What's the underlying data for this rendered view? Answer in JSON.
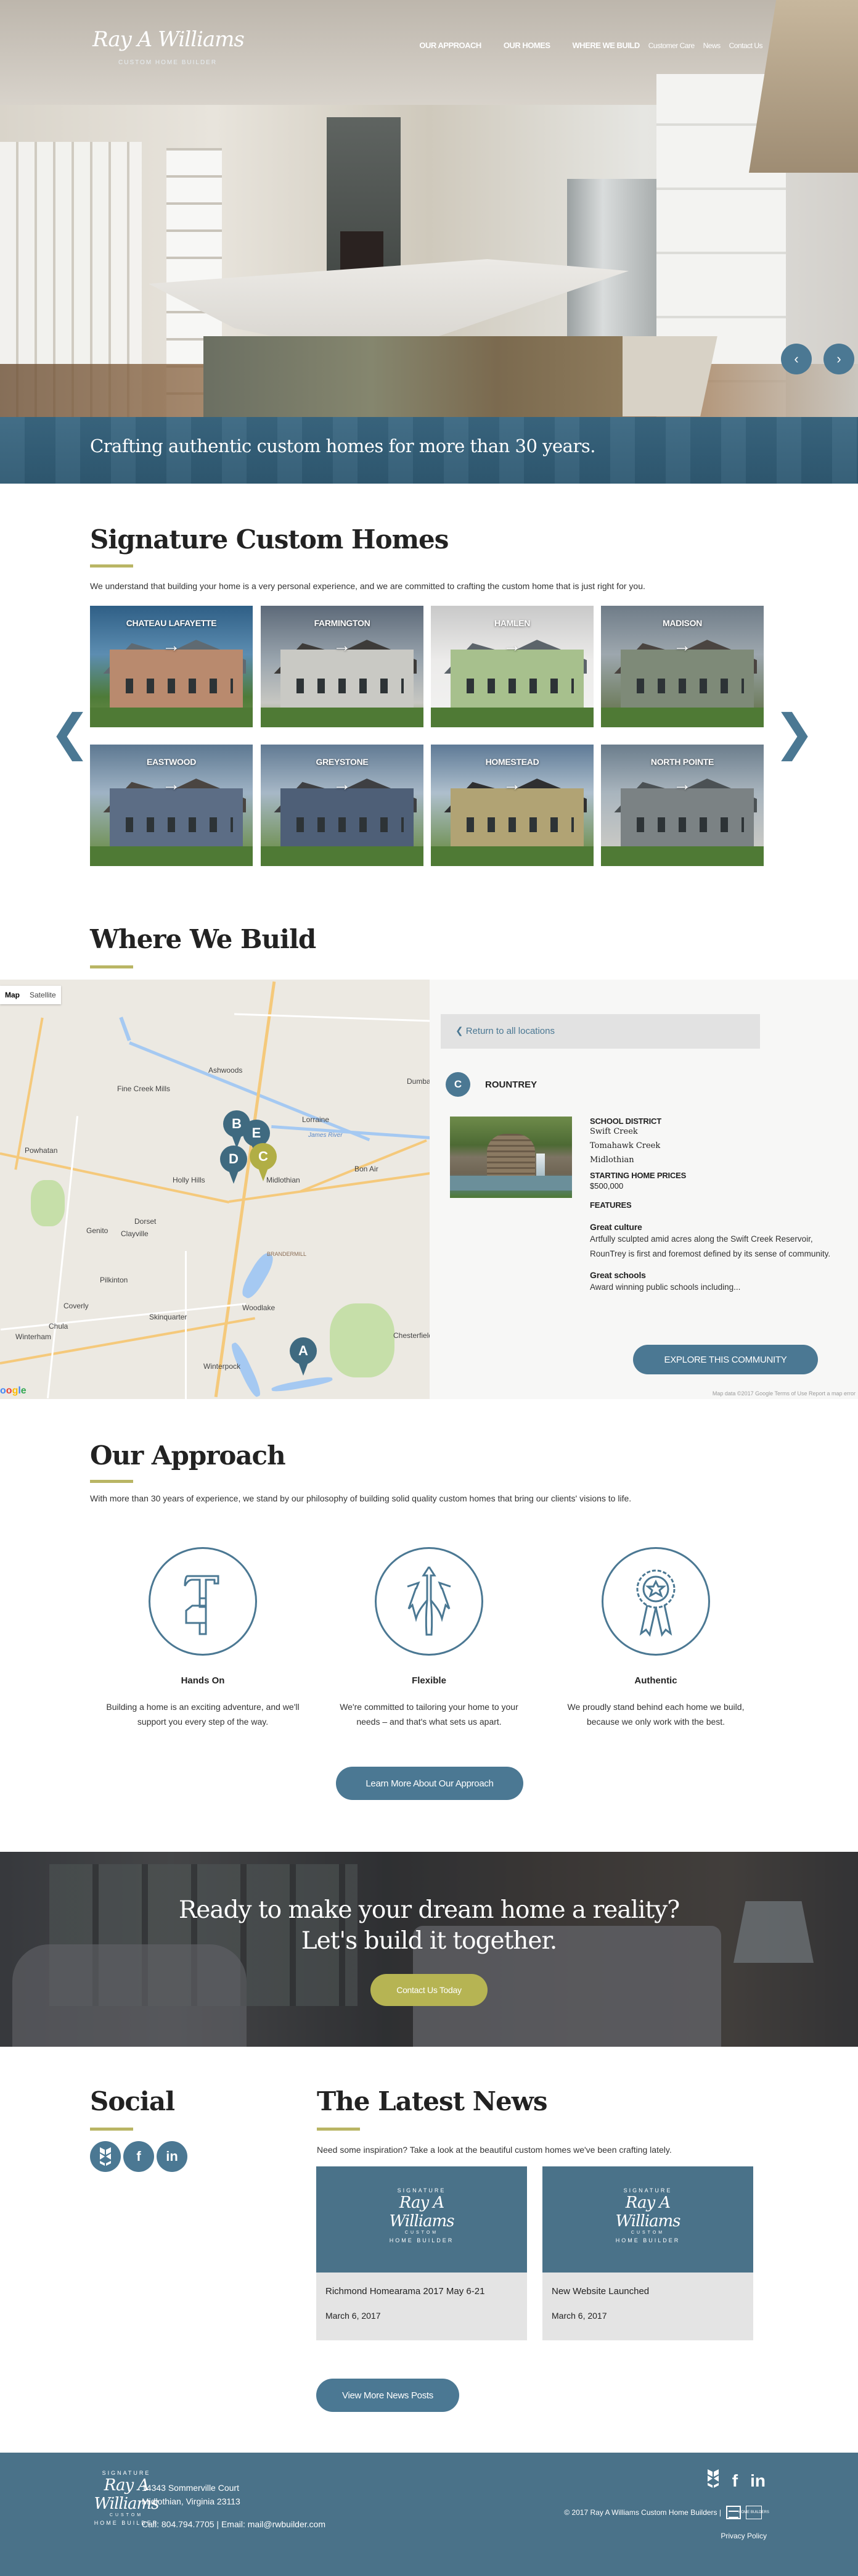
{
  "brand": {
    "logo_script": "Ray A Williams",
    "logo_sub": "CUSTOM HOME BUILDER",
    "emblem_top": "SIGNATURE",
    "emblem_mid": "CUSTOM",
    "emblem_bottom": "HOME BUILDER"
  },
  "nav": {
    "items": [
      {
        "label": "OUR APPROACH",
        "primary": true
      },
      {
        "label": "OUR HOMES",
        "primary": true
      },
      {
        "label": "WHERE WE BUILD",
        "primary": true
      },
      {
        "label": "Customer Care",
        "primary": false
      },
      {
        "label": "News",
        "primary": false
      },
      {
        "label": "Contact Us",
        "primary": false
      }
    ]
  },
  "hero": {
    "prev_icon": "‹",
    "next_icon": "›",
    "tagline": "Crafting authentic custom homes for more than 30 years."
  },
  "homes": {
    "title": "Signature Custom Homes",
    "lead": "We understand that building your home is a very personal experience, and we are committed to crafting the custom home that is just right for you.",
    "prev_icon": "❮",
    "next_icon": "❯",
    "arrow_icon": "→",
    "items": [
      {
        "name": "CHATEAU LAFAYETTE"
      },
      {
        "name": "FARMINGTON"
      },
      {
        "name": "HAMLEN"
      },
      {
        "name": "MADISON"
      },
      {
        "name": "EASTWOOD"
      },
      {
        "name": "GREYSTONE"
      },
      {
        "name": "HOMESTEAD"
      },
      {
        "name": "NORTH POINTE"
      }
    ]
  },
  "where": {
    "title": "Where We Build",
    "map_type": {
      "map": "Map",
      "satellite": "Satellite"
    },
    "map_labels": [
      "Ashwoods",
      "Fine Creek Mills",
      "Powhatan",
      "Lorraine",
      "James River",
      "Holly Hills",
      "Midlothian",
      "Bon Air",
      "Dorset",
      "Genito",
      "Clayville",
      "BRANDERMILL",
      "Pilkinton",
      "Woodlake",
      "Coverly",
      "Skinquarter",
      "Chula",
      "Winterham",
      "Chesterfield",
      "Winterpock",
      "Dumbarton"
    ],
    "pins": [
      {
        "letter": "B",
        "color": "#3f6a80"
      },
      {
        "letter": "E",
        "color": "#3f6a80"
      },
      {
        "letter": "D",
        "color": "#3f6a80"
      },
      {
        "letter": "C",
        "color": "#b1ae45"
      },
      {
        "letter": "A",
        "color": "#3f6a80"
      }
    ],
    "google_label": "Google",
    "return_label": "❮ Return to all locations",
    "community": {
      "badge": "C",
      "name": "ROUNTREY",
      "school_district_label": "SCHOOL DISTRICT",
      "schools": [
        "Swift Creek",
        "Tomahawk Creek",
        "Midlothian"
      ],
      "price_label": "STARTING HOME PRICES",
      "price": "$500,000",
      "features_label": "FEATURES",
      "features": [
        {
          "title": "Great culture",
          "text": "Artfully sculpted amid acres along the Swift Creek Reservoir, RounTrey is first and foremost defined by its sense of community."
        },
        {
          "title": "Great schools",
          "text": "Award winning public schools including..."
        }
      ],
      "explore_label": "EXPLORE THIS COMMUNITY"
    },
    "attribution": "Map data ©2017 Google   Terms of Use   Report a map error"
  },
  "approach": {
    "title": "Our Approach",
    "lead": "With more than 30 years of experience, we stand by our philosophy of building solid quality custom homes that bring our clients' visions to life.",
    "features": [
      {
        "icon": "hammer-icon",
        "title": "Hands On",
        "text": "Building a home is an exciting adventure, and we'll support you every step of the way."
      },
      {
        "icon": "diverging-arrows-icon",
        "title": "Flexible",
        "text": "We're committed to tailoring your home to your needs – and that's what sets us apart."
      },
      {
        "icon": "award-ribbon-icon",
        "title": "Authentic",
        "text": "We proudly stand behind each home we build, because we only work with the best."
      }
    ],
    "button_label": "Learn More About Our Approach"
  },
  "cta": {
    "line1": "Ready to make your dream home a reality?",
    "line2": "Let's build it together.",
    "button_label": "Contact Us Today"
  },
  "social": {
    "title": "Social",
    "icons": [
      {
        "name": "houzz-icon",
        "glyph": "h"
      },
      {
        "name": "facebook-icon",
        "glyph": "f"
      },
      {
        "name": "linkedin-icon",
        "glyph": "in"
      }
    ]
  },
  "news": {
    "title": "The Latest News",
    "lead": "Need some inspiration? Take a look at the beautiful custom homes we've been crafting lately.",
    "posts": [
      {
        "title": "Richmond Homearama 2017 May 6-21",
        "date": "March 6, 2017"
      },
      {
        "title": "New Website Launched",
        "date": "March 6, 2017"
      }
    ],
    "button_label": "View More News Posts"
  },
  "footer": {
    "address_line1": "14343 Sommerville Court",
    "address_line2": "Midlothian, Virginia 23113",
    "contact": "Call: 804.794.7705 | Email: mail@rwbuilder.com",
    "copyright": "© 2017 Ray A Williams Custom Home Builders  |",
    "privacy_label": "Privacy Policy",
    "hba_label": "HOME BUILDERS"
  },
  "colors": {
    "brand_blue": "#4b7893",
    "olive": "#b6b453",
    "footer_blue": "#4a7289"
  }
}
